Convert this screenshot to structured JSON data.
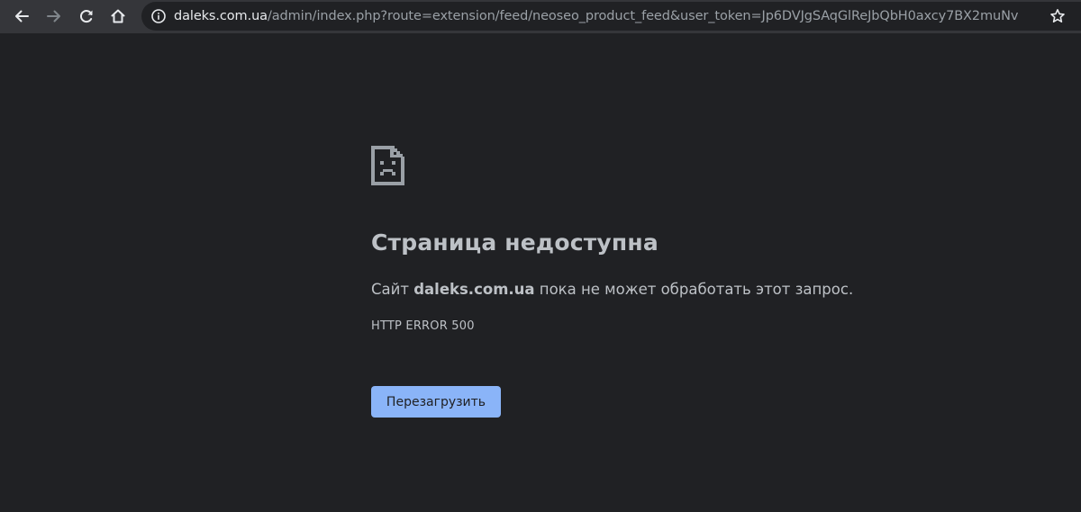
{
  "browser": {
    "url_domain": "daleks.com.ua",
    "url_path": "/admin/index.php?route=extension/feed/neoseo_product_feed&user_token=Jp6DVJgSAqGlReJbQbH0axcy7BX2muNv",
    "icons": {
      "back": "back-arrow-icon",
      "forward": "forward-arrow-icon",
      "reload": "reload-icon",
      "home": "home-icon",
      "site_info": "info-icon",
      "bookmark": "star-icon"
    }
  },
  "error_page": {
    "icon": "sad-page-icon",
    "heading": "Страница недоступна",
    "message_prefix": "Сайт",
    "message_domain": "daleks.com.ua",
    "message_suffix": "пока не может обработать этот запрос.",
    "error_code": "HTTP ERROR 500",
    "reload_button_label": "Перезагрузить"
  },
  "colors": {
    "page_background": "#202124",
    "toolbar_background": "#35363a",
    "text": "#bdc1c6",
    "button_background": "#8ab4f8",
    "button_text": "#202124"
  }
}
